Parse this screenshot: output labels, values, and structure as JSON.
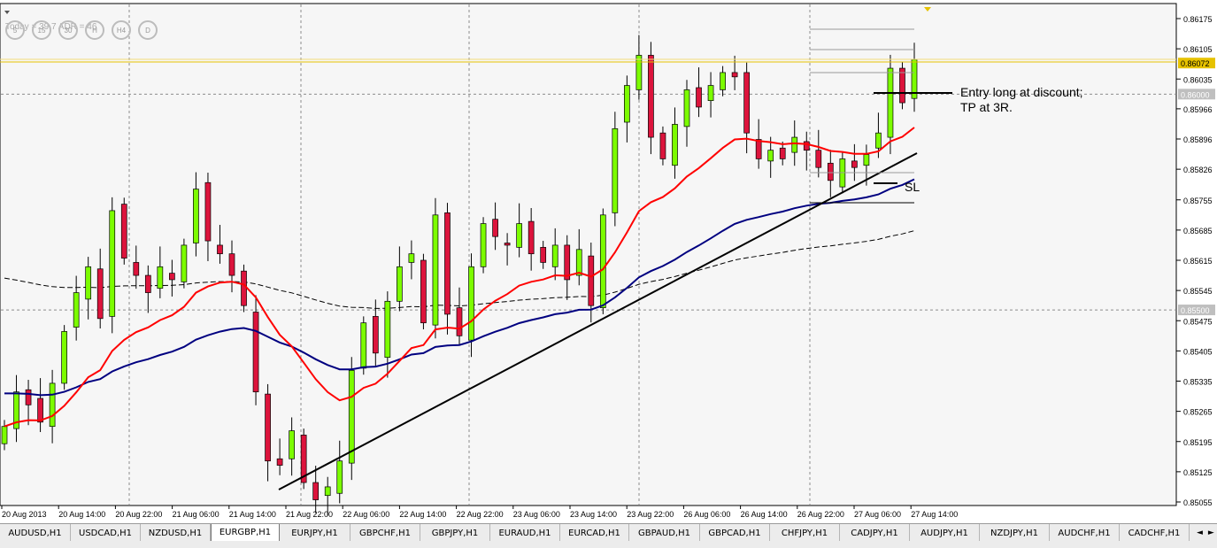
{
  "chart_window": {
    "symbol": "EURGBP,H1",
    "info_text": "Today = 39.7  ADR = 46",
    "timeframe_buttons": [
      "5",
      "15",
      "30",
      "H",
      "H4",
      "D"
    ]
  },
  "price_axis": {
    "ticks": [
      "0.86175",
      "0.86105",
      "0.86035",
      "0.85966",
      "0.85896",
      "0.85826",
      "0.85755",
      "0.85685",
      "0.85615",
      "0.85545",
      "0.85475",
      "0.85405",
      "0.85335",
      "0.85265",
      "0.85195",
      "0.85125",
      "0.85055"
    ],
    "labels": [
      "0.86072",
      "0.86000",
      "0.85500"
    ],
    "range": [
      0.8503,
      0.8622
    ]
  },
  "time_axis": {
    "labels": [
      "20 Aug 2013",
      "20 Aug 14:00",
      "20 Aug 22:00",
      "21 Aug 06:00",
      "21 Aug 14:00",
      "21 Aug 22:00",
      "22 Aug 06:00",
      "22 Aug 14:00",
      "22 Aug 22:00",
      "23 Aug 06:00",
      "23 Aug 14:00",
      "23 Aug 22:00",
      "26 Aug 06:00",
      "26 Aug 14:00",
      "26 Aug 22:00",
      "27 Aug 06:00",
      "27 Aug 14:00"
    ]
  },
  "annotations": {
    "entry_text_line1": "Entry long at discount;",
    "entry_text_line2": "TP at 3R.",
    "sl_text": "SL"
  },
  "symbol_tabs": [
    "AUDUSD,H1",
    "USDCAD,H1",
    "NZDUSD,H1",
    "EURGBP,H1",
    "EURJPY,H1",
    "GBPCHF,H1",
    "GBPJPY,H1",
    "EURAUD,H1",
    "EURCAD,H1",
    "GBPAUD,H1",
    "GBPCAD,H1",
    "CHFJPY,H1",
    "CADJPY,H1",
    "AUDJPY,H1",
    "NZDJPY,H1",
    "AUDCHF,H1",
    "CADCHF,H1"
  ],
  "active_tab": 3,
  "scroll_left": "◄",
  "scroll_right": "►",
  "colors": {
    "bull": "#7cfc00",
    "bear": "#dc143c",
    "ma_fast": "#ff0000",
    "ma_mid": "#000080",
    "ma_slow": "#000000",
    "current_price": "#e6c200",
    "trendline": "#000000"
  },
  "chart_data": {
    "type": "candlestick",
    "instrument": "EURGBP",
    "timeframe": "H1",
    "close_series": [
      0.8523,
      0.8531,
      0.8528,
      0.8524,
      0.8533,
      0.8545,
      0.8554,
      0.856,
      0.8548,
      0.8573,
      0.8562,
      0.8558,
      0.8554,
      0.856,
      0.8557,
      0.8565,
      0.8578,
      0.8566,
      0.8563,
      0.8558,
      0.8551,
      0.8531,
      0.8515,
      0.8514,
      0.8522,
      0.851,
      0.8506,
      0.8509,
      0.8515,
      0.8536,
      0.8547,
      0.854,
      0.8552,
      0.856,
      0.8563,
      0.8547,
      0.8572,
      0.8549,
      0.8544,
      0.856,
      0.857,
      0.8567,
      0.8565,
      0.857,
      0.8563,
      0.8561,
      0.8565,
      0.8557,
      0.8564,
      0.8551,
      0.8572,
      0.8592,
      0.8602,
      0.8609,
      0.859,
      0.8585,
      0.8593,
      0.8601,
      0.8597,
      0.8602,
      0.8605,
      0.8604,
      0.8591,
      0.8585,
      0.8587,
      0.8585,
      0.859,
      0.8587,
      0.8583,
      0.858,
      0.8585,
      0.8583,
      0.8586,
      0.8591,
      0.8606,
      0.8598,
      0.8608
    ],
    "moving_averages": [
      {
        "color": "red",
        "style": "solid"
      },
      {
        "color": "navy",
        "style": "solid"
      },
      {
        "color": "black",
        "style": "dashed"
      }
    ]
  }
}
